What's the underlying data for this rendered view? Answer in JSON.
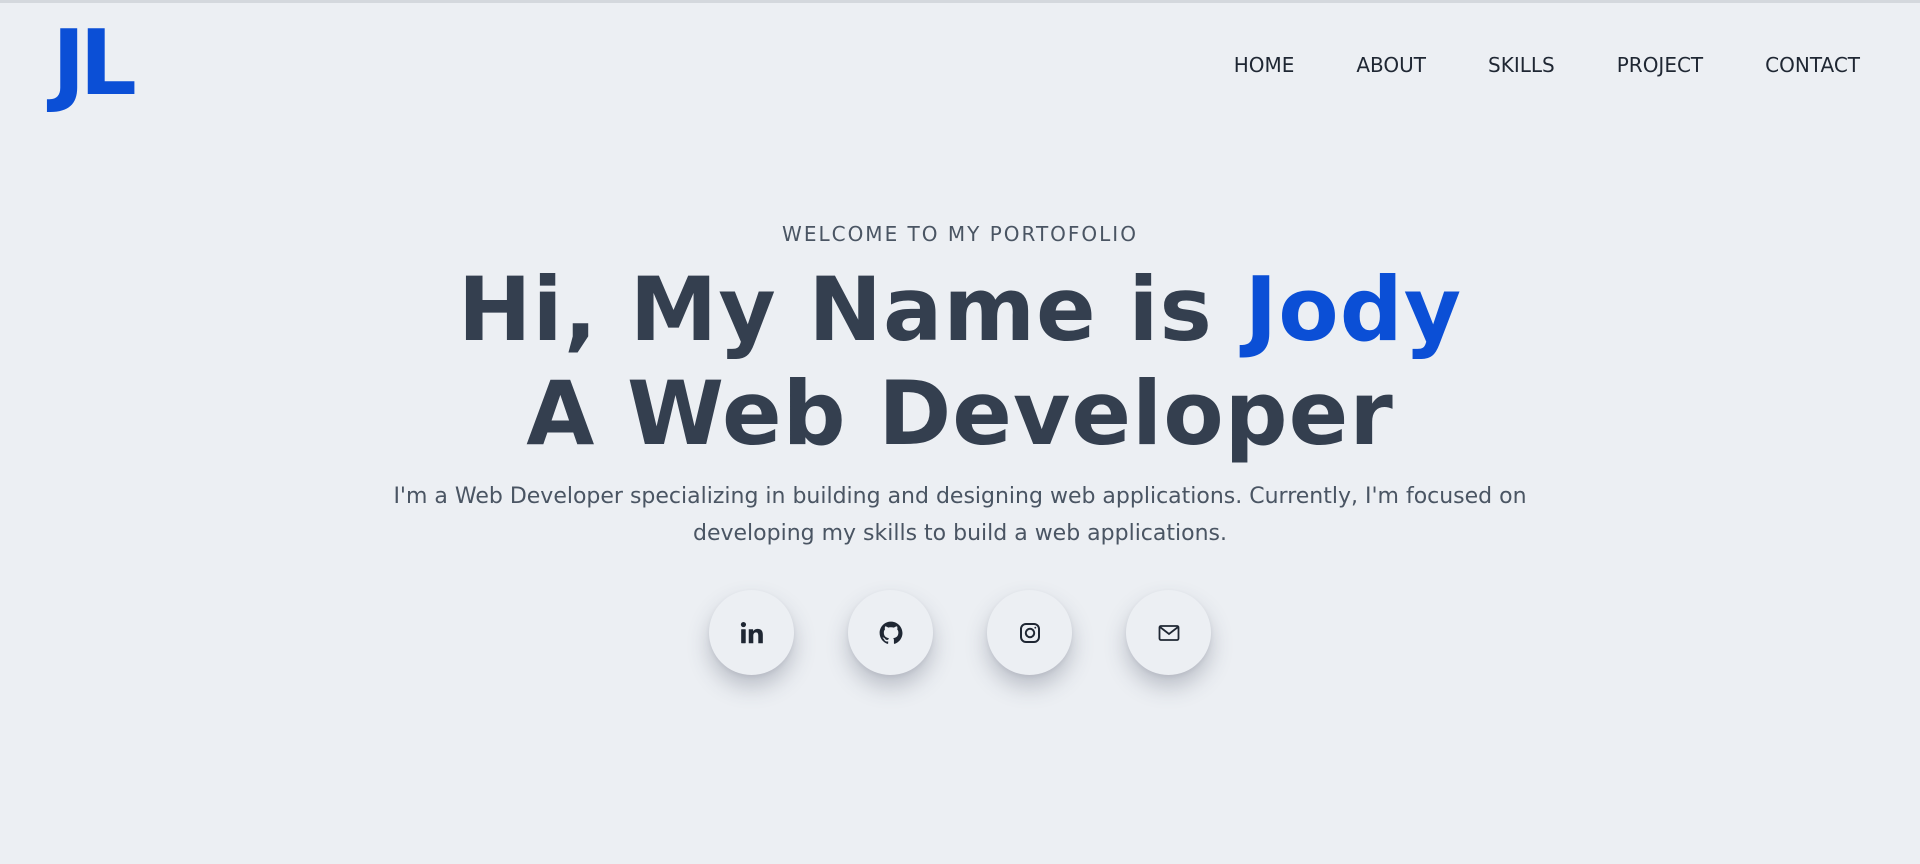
{
  "header": {
    "logo": "JL",
    "nav": [
      {
        "label": "HOME"
      },
      {
        "label": "ABOUT"
      },
      {
        "label": "SKILLS"
      },
      {
        "label": "PROJECT"
      },
      {
        "label": "CONTACT"
      }
    ]
  },
  "hero": {
    "eyebrow": "WELCOME TO MY PORTOFOLIO",
    "headline_prefix": "Hi, My Name is ",
    "headline_name": "Jody",
    "headline_line2": "A Web Developer",
    "bio_line1": "I'm a Web Developer specializing in building and designing web applications. Currently, I'm focused on",
    "bio_line2": "developing my skills to build a web applications."
  },
  "socials": [
    {
      "icon": "linkedin-icon"
    },
    {
      "icon": "github-icon"
    },
    {
      "icon": "instagram-icon"
    },
    {
      "icon": "mail-icon"
    }
  ],
  "colors": {
    "background": "#eceff3",
    "accent": "#0b4fd6",
    "heading": "#343f4f",
    "text": "#4a5563"
  }
}
